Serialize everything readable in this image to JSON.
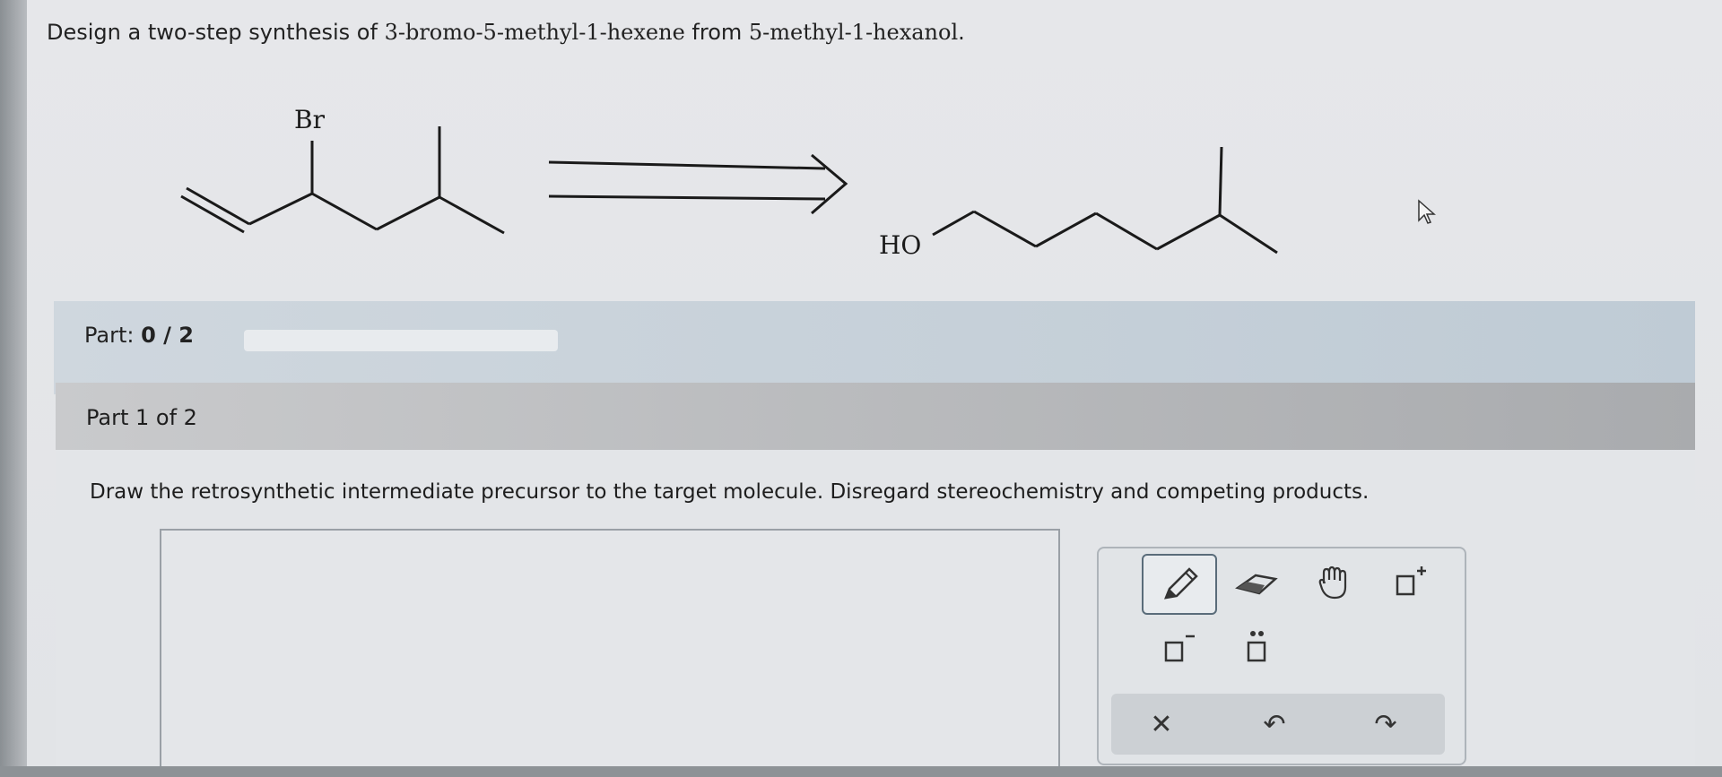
{
  "question": {
    "prefix": "Design a two-step synthesis of ",
    "target": "3-bromo-5-methyl-1-hexene",
    "middle": " from ",
    "start": "5-methyl-1-hexanol",
    "suffix": "."
  },
  "scheme": {
    "target_atom_label": "Br",
    "start_atom_label": "HO"
  },
  "progress": {
    "label": "Part:",
    "value": "0 / 2",
    "completed": 0,
    "total": 2
  },
  "part": {
    "header": "Part 1 of 2",
    "instruction": "Draw the retrosynthetic intermediate precursor to the target molecule. Disregard stereochemistry and competing products."
  },
  "toolbox": {
    "tools": [
      "pencil-icon",
      "eraser-icon",
      "hand-icon",
      "add-charge-icon",
      "remove-charge-icon",
      "lone-pair-icon"
    ],
    "buttons": [
      {
        "name": "clear-button",
        "glyph": "✕"
      },
      {
        "name": "undo-button",
        "glyph": "↶"
      },
      {
        "name": "redo-button",
        "glyph": "↷"
      }
    ]
  }
}
